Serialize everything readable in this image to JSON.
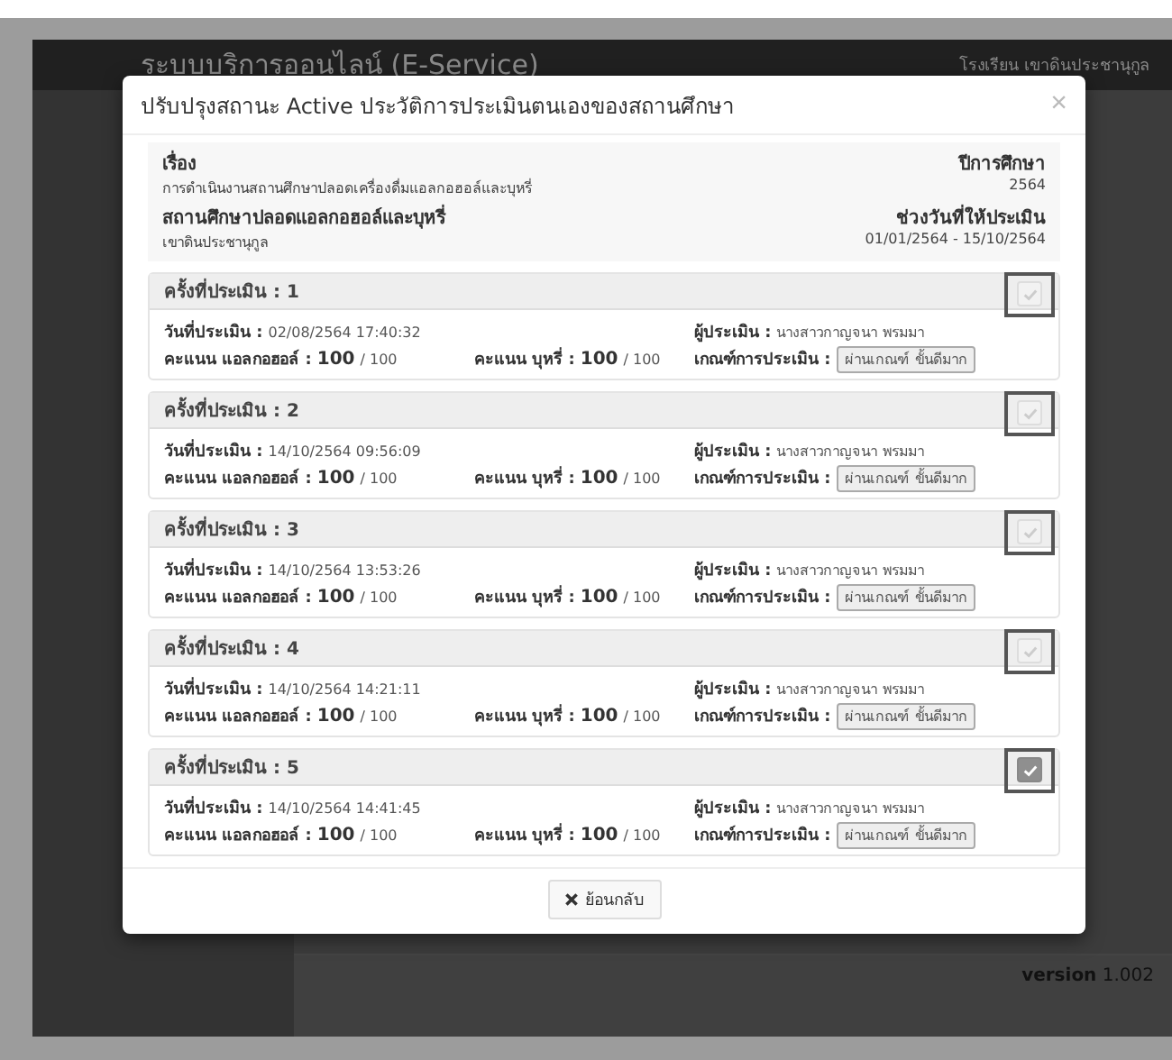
{
  "background": {
    "app_title": "ระบบบริการออนไลน์ (E-Service)",
    "user": "โรงเรียน เขาดินประชานุกูล",
    "version": "**version** 1.002"
  },
  "modal": {
    "title": "ปรับปรุงสถานะ Active ประวัติการประเมินตนเองของสถานศึกษา",
    "close": "×",
    "info": {
      "subject_label": "เรื่อง",
      "subject": "การดำเนินงานสถานศึกษาปลอดเครื่องดื่มแอลกอฮอล์และบุหรี่",
      "year_label": "ปีการศึกษา",
      "year": "2564",
      "school_label": "สถานศึกษาปลอดแอลกอฮอล์และบุหรี่",
      "school": "เขาดินประชานุกูล",
      "period_label": "ช่วงวันที่ให้ประเมิน",
      "period": "01/01/2564 - 15/10/2564"
    },
    "records": [
      {
        "title": "ครั้งที่ประเมิน : 1",
        "checked": false,
        "date_label": "วันที่ประเมิน :",
        "date": "02/08/2564 17:40:32",
        "assessor_label": "ผู้ประเมิน :",
        "assessor": "นางสาวกาญจนา พรมมา",
        "alcohol_label": "คะแนน แอลกอฮอล์ :",
        "alcohol_score": "100",
        "alcohol_max": "/ 100",
        "tobacco_label": "คะแนน บุหรี่ :",
        "tobacco_score": "100",
        "tobacco_max": "/ 100",
        "criteria_label": "เกณฑ์การประเมิน :",
        "criteria": "ผ่านเกณฑ์ ขั้นดีมาก"
      },
      {
        "title": "ครั้งที่ประเมิน : 2",
        "checked": false,
        "date_label": "วันที่ประเมิน :",
        "date": "14/10/2564 09:56:09",
        "assessor_label": "ผู้ประเมิน :",
        "assessor": "นางสาวกาญจนา พรมมา",
        "alcohol_label": "คะแนน แอลกอฮอล์ :",
        "alcohol_score": "100",
        "alcohol_max": "/ 100",
        "tobacco_label": "คะแนน บุหรี่ :",
        "tobacco_score": "100",
        "tobacco_max": "/ 100",
        "criteria_label": "เกณฑ์การประเมิน :",
        "criteria": "ผ่านเกณฑ์ ขั้นดีมาก"
      },
      {
        "title": "ครั้งที่ประเมิน : 3",
        "checked": false,
        "date_label": "วันที่ประเมิน :",
        "date": "14/10/2564 13:53:26",
        "assessor_label": "ผู้ประเมิน :",
        "assessor": "นางสาวกาญจนา พรมมา",
        "alcohol_label": "คะแนน แอลกอฮอล์ :",
        "alcohol_score": "100",
        "alcohol_max": "/ 100",
        "tobacco_label": "คะแนน บุหรี่ :",
        "tobacco_score": "100",
        "tobacco_max": "/ 100",
        "criteria_label": "เกณฑ์การประเมิน :",
        "criteria": "ผ่านเกณฑ์ ขั้นดีมาก"
      },
      {
        "title": "ครั้งที่ประเมิน : 4",
        "checked": false,
        "date_label": "วันที่ประเมิน :",
        "date": "14/10/2564 14:21:11",
        "assessor_label": "ผู้ประเมิน :",
        "assessor": "นางสาวกาญจนา พรมมา",
        "alcohol_label": "คะแนน แอลกอฮอล์ :",
        "alcohol_score": "100",
        "alcohol_max": "/ 100",
        "tobacco_label": "คะแนน บุหรี่ :",
        "tobacco_score": "100",
        "tobacco_max": "/ 100",
        "criteria_label": "เกณฑ์การประเมิน :",
        "criteria": "ผ่านเกณฑ์ ขั้นดีมาก"
      },
      {
        "title": "ครั้งที่ประเมิน : 5",
        "checked": true,
        "date_label": "วันที่ประเมิน :",
        "date": "14/10/2564 14:41:45",
        "assessor_label": "ผู้ประเมิน :",
        "assessor": "นางสาวกาญจนา พรมมา",
        "alcohol_label": "คะแนน แอลกอฮอล์ :",
        "alcohol_score": "100",
        "alcohol_max": "/ 100",
        "tobacco_label": "คะแนน บุหรี่ :",
        "tobacco_score": "100",
        "tobacco_max": "/ 100",
        "criteria_label": "เกณฑ์การประเมิน :",
        "criteria": "ผ่านเกณฑ์ ขั้นดีมาก"
      }
    ],
    "back_button": "ย้อนกลับ"
  }
}
